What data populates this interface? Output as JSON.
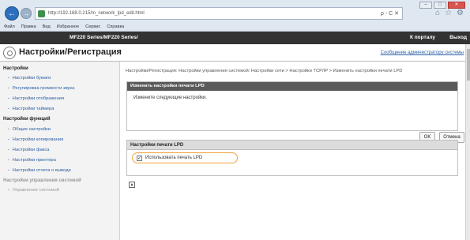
{
  "browser": {
    "address": "http://192.168.0.215/m_network_lpd_edit.html",
    "address_tools": "ρ - C ✕",
    "menu": [
      "Файл",
      "Правка",
      "Вид",
      "Избранное",
      "Сервис",
      "Справка"
    ]
  },
  "device": {
    "name": "MF220 Series/MF220 Series/",
    "portal_link": "К порталу",
    "logout": "Выход"
  },
  "page": {
    "title": "Настройки/Регистрация",
    "admin_message": "Сообщение администратору системы"
  },
  "sidebar": {
    "section_settings": "Настройки",
    "settings_items": [
      "Настройки бумаги",
      "Регулировка громкости звука",
      "Настройки отображения",
      "Настройки таймера"
    ],
    "section_functions": "Настройки функций",
    "function_items": [
      "Общие настройки",
      "Настройки копирования",
      "Настройки факса",
      "Настройки принтера",
      "Настройки отчета о выводе"
    ],
    "section_system": "Настройки управления системой",
    "system_items": [
      "Управление системой"
    ]
  },
  "main": {
    "breadcrumb": "Настройки/Регистрация: Настройки управления системой: Настройки сети > Настройки TCP/IP > Изменить настройки печати LPD",
    "panel1_title": "Изменить настройки печати LPD",
    "panel1_text": "Измените следующие настройки.",
    "ok_label": "OK",
    "cancel_label": "Отмена",
    "panel2_title": "Настройки печати LPD",
    "checkbox_label": "Использовать печать LPD",
    "checkbox_checked": true
  }
}
